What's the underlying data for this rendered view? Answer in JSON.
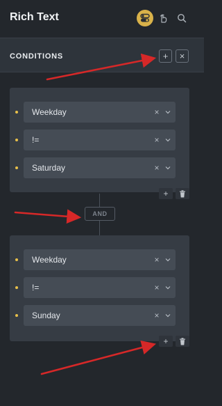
{
  "header": {
    "title": "Rich Text",
    "icons": [
      "conditions-toggle-icon",
      "pointer-icon",
      "search-icon"
    ]
  },
  "conditions": {
    "title": "CONDITIONS",
    "add_icon": "+",
    "close_icon": "×"
  },
  "groups": [
    {
      "rows": [
        {
          "value": "Weekday"
        },
        {
          "value": "!="
        },
        {
          "value": "Saturday"
        }
      ]
    },
    {
      "rows": [
        {
          "value": "Weekday"
        },
        {
          "value": "!="
        },
        {
          "value": "Sunday"
        }
      ]
    }
  ],
  "connector": {
    "label": "AND"
  },
  "glyphs": {
    "clear": "×",
    "add": "+"
  },
  "colors": {
    "accent": "#d9b24a",
    "dot": "#e8c04a",
    "annotation_arrow": "#d62828"
  }
}
